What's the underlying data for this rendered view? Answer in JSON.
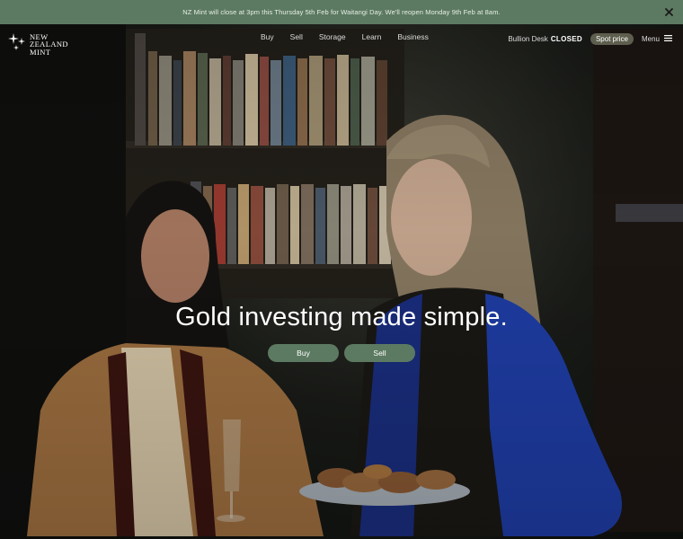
{
  "announcement": {
    "text": "NZ Mint will close at 3pm this Thursday 5th Feb for Waitangi Day. We'll reopen Monday 9th Feb at 8am.",
    "close_icon": "close-icon"
  },
  "logo": {
    "line1": "New",
    "line2": "Zealand",
    "line3": "Mint",
    "icon": "sparkle-stars-icon"
  },
  "nav": {
    "items": [
      {
        "label": "Buy"
      },
      {
        "label": "Sell"
      },
      {
        "label": "Storage"
      },
      {
        "label": "Learn"
      },
      {
        "label": "Business"
      }
    ]
  },
  "header_right": {
    "bullion_label": "Bullion Desk",
    "bullion_status": "CLOSED",
    "spot_price_label": "Spot price",
    "menu_label": "Menu",
    "menu_icon": "hamburger-icon"
  },
  "hero": {
    "headline": "Gold investing made simple.",
    "buy_label": "Buy",
    "sell_label": "Sell"
  },
  "colors": {
    "accent_green": "#5c7a61",
    "spot_pill": "#5e5e4e"
  }
}
